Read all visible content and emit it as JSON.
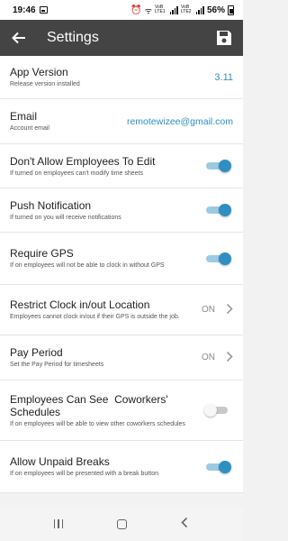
{
  "status": {
    "time": "19:46",
    "network_1": "VoB LTE1",
    "network_2": "VoB LTE2",
    "battery": "56%"
  },
  "header": {
    "title": "Settings",
    "back_icon": "arrow-left-icon",
    "save_icon": "floppy-disk-icon"
  },
  "settings": {
    "app_version": {
      "title": "App Version",
      "subtitle": "Release version installed",
      "value": "3.11"
    },
    "email": {
      "title": "Email",
      "subtitle": "Account email",
      "value": "remotewizee@gmail.com"
    },
    "no_edit": {
      "title": "Don't Allow Employees To Edit",
      "subtitle": "If turned on employees can't modify time sheets",
      "on": true
    },
    "push": {
      "title": "Push Notification",
      "subtitle": "If turned on you will receive notifications",
      "on": true
    },
    "gps": {
      "title": "Require GPS",
      "subtitle": "If on employees will not be able to clock in without GPS",
      "on": true
    },
    "restrict": {
      "title": "Restrict Clock in/out Location",
      "subtitle": "Employees cannot clock in/out if their GPS is outside the job.",
      "value": "ON"
    },
    "pay_period": {
      "title": "Pay Period",
      "subtitle": "Set the Pay Period for timesheets",
      "value": "ON"
    },
    "coworkers": {
      "title": "Employees Can See  Coworkers' Schedules",
      "subtitle": "If on employees will be able to view other coworkers schedules",
      "on": false
    },
    "unpaid": {
      "title": "Allow Unpaid Breaks",
      "subtitle": "If on employees will be presented with a break button",
      "on": true
    }
  },
  "colors": {
    "app_bar": "#444444",
    "accent": "#2f8fc2",
    "toggle_track_on": "#9ccae3",
    "toggle_off": "#c9c9c9"
  }
}
